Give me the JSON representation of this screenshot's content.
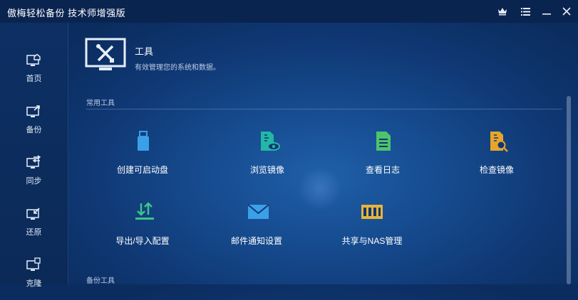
{
  "window": {
    "title": "傲梅轻松备份 技术师增强版"
  },
  "sidebar": {
    "items": [
      {
        "label": "首页",
        "icon": "home-icon"
      },
      {
        "label": "备份",
        "icon": "backup-icon"
      },
      {
        "label": "同步",
        "icon": "sync-icon"
      },
      {
        "label": "还原",
        "icon": "restore-icon"
      },
      {
        "label": "克隆",
        "icon": "clone-icon"
      }
    ]
  },
  "header": {
    "title": "工具",
    "subtitle": "有效管理您的系统和数据。"
  },
  "sections": {
    "common": "常用工具",
    "backup": "备份工具"
  },
  "tools": [
    {
      "label": "创建可启动盘",
      "icon": "usb-drive-icon",
      "color": "#3aa0e8"
    },
    {
      "label": "浏览镜像",
      "icon": "explore-image-icon",
      "color": "#23b7a6"
    },
    {
      "label": "查看日志",
      "icon": "log-file-icon",
      "color": "#4cc46a"
    },
    {
      "label": "检查镜像",
      "icon": "check-image-icon",
      "color": "#e6a52a"
    },
    {
      "label": "导出/导入配置",
      "icon": "export-import-icon",
      "color": "#3fc38a"
    },
    {
      "label": "邮件通知设置",
      "icon": "mail-icon",
      "color": "#3aa0e8"
    },
    {
      "label": "共享与NAS管理",
      "icon": "nas-icon",
      "color": "#e6b53a"
    }
  ]
}
